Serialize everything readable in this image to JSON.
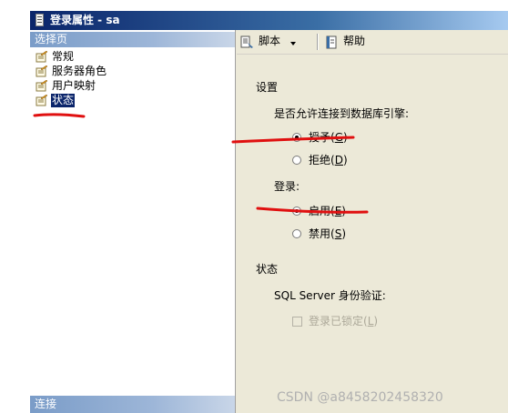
{
  "window": {
    "title": "登录属性 - sa"
  },
  "left_pane": {
    "header": "选择页",
    "items": [
      {
        "label": "常规",
        "selected": false
      },
      {
        "label": "服务器角色",
        "selected": false
      },
      {
        "label": "用户映射",
        "selected": false
      },
      {
        "label": "状态",
        "selected": true
      }
    ],
    "footer": "连接"
  },
  "toolbar": {
    "script_label": "脚本",
    "help_label": "帮助"
  },
  "settings": {
    "section_title": "设置",
    "db_engine_question": "是否允许连接到数据库引擎:",
    "grant_text": "授予",
    "grant_key": "G",
    "deny_text": "拒绝",
    "deny_key": "D",
    "selected_permission": "grant",
    "login_label": "登录:",
    "enabled_text": "启用",
    "enabled_key": "E",
    "disabled_text": "禁用",
    "disabled_key": "S",
    "selected_login": "enabled"
  },
  "status": {
    "section_title": "状态",
    "auth_label": "SQL Server 身份验证:",
    "locked_text": "登录已锁定",
    "locked_key": "L",
    "locked_checked": false
  },
  "annotation_color": "#e01010",
  "watermark": "CSDN @a8458202458320"
}
